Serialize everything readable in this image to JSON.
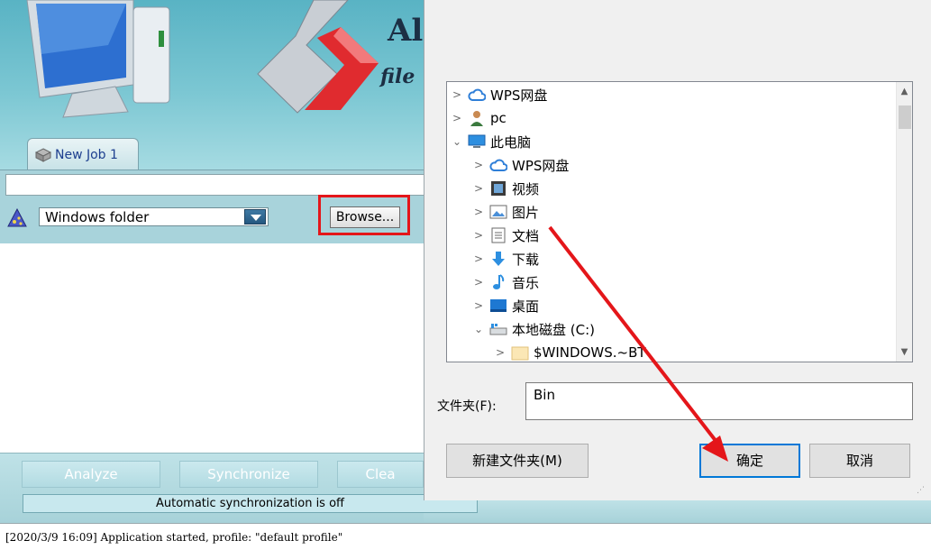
{
  "app": {
    "brand_title": "Al",
    "brand_subtitle": "file",
    "job_tab_label": "New Job 1",
    "path_value": "",
    "folder_type": "Windows folder",
    "browse_label": "Browse...",
    "buttons": {
      "analyze": "Analyze",
      "synchronize": "Synchronize",
      "clear": "Clea"
    },
    "auto_sync_status": "Automatic synchronization is off",
    "log_line": "[2020/3/9 16:09] Application started, profile: \"default profile\""
  },
  "dialog": {
    "tree": [
      {
        "label": "WPS网盘",
        "icon": "cloud-icon",
        "expanded": false
      },
      {
        "label": "pc",
        "icon": "user-icon",
        "expanded": false
      },
      {
        "label": "此电脑",
        "icon": "computer-icon",
        "expanded": true
      },
      {
        "label": "WPS网盘",
        "icon": "cloud-icon",
        "expanded": false
      },
      {
        "label": "视频",
        "icon": "video-icon",
        "expanded": false
      },
      {
        "label": "图片",
        "icon": "image-icon",
        "expanded": false
      },
      {
        "label": "文档",
        "icon": "document-icon",
        "expanded": false
      },
      {
        "label": "下载",
        "icon": "download-icon",
        "expanded": false
      },
      {
        "label": "音乐",
        "icon": "music-icon",
        "expanded": false
      },
      {
        "label": "桌面",
        "icon": "desktop-icon",
        "expanded": false
      },
      {
        "label": "本地磁盘 (C:)",
        "icon": "drive-icon",
        "expanded": true
      },
      {
        "label": "$WINDOWS.~BT",
        "icon": "folder-icon",
        "expanded": false
      }
    ],
    "folder_label": "文件夹(F):",
    "folder_value": "Bin",
    "new_folder_label": "新建文件夹(M)",
    "ok_label": "确定",
    "cancel_label": "取消"
  },
  "colors": {
    "highlight": "#e4161a",
    "accent": "#0078d7",
    "banner": "#7cc7d3"
  }
}
